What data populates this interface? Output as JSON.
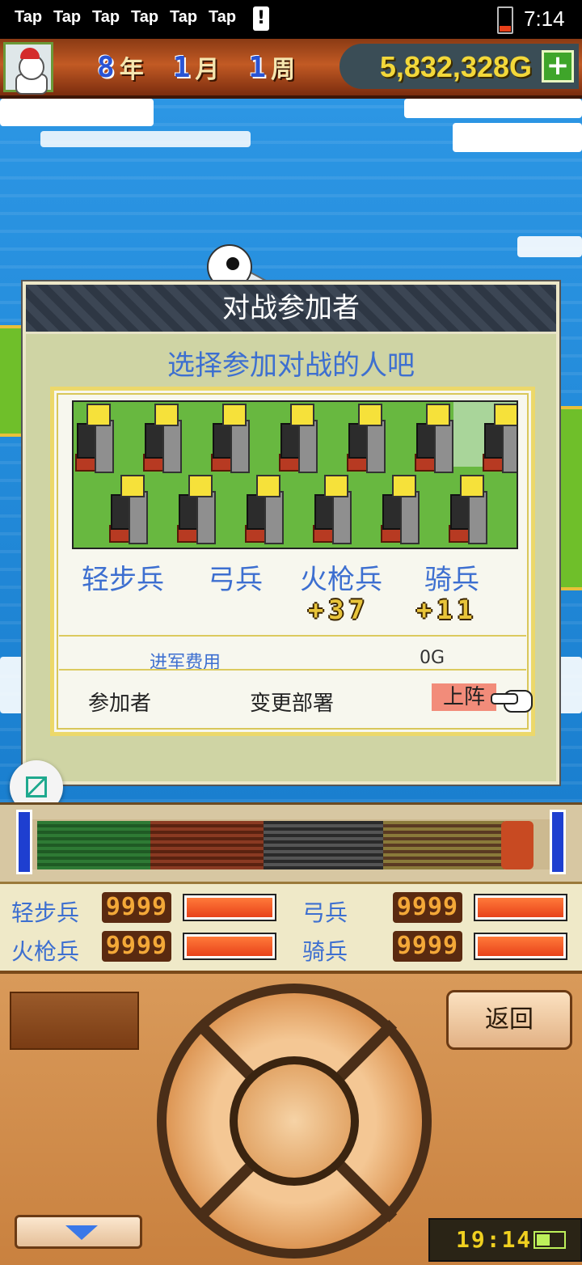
{
  "status_bar": {
    "tap_labels": [
      "Tap",
      "Tap",
      "Tap",
      "Tap",
      "Tap",
      "Tap"
    ],
    "warning_glyph": "!",
    "time": "7:14",
    "battery_level_fraction": 0.25
  },
  "header": {
    "year": "8",
    "year_unit": "年",
    "month": "1",
    "month_unit": "月",
    "week": "1",
    "week_unit": "周",
    "money": "5,832,328G",
    "add_money_glyph": "+"
  },
  "dialog": {
    "title": "对战参加者",
    "subtitle": "选择参加对战的人吧",
    "units": [
      "轻步兵",
      "弓兵",
      "火枪兵",
      "骑兵"
    ],
    "bonuses": [
      "",
      "",
      "+37",
      "+11"
    ],
    "cost_label": "进军费用",
    "cost_value": "0G",
    "participants_label": "参加者",
    "change_formation_label": "变更部署",
    "deploy_label": "上阵"
  },
  "stats": [
    {
      "label": "轻步兵",
      "value": "9999",
      "fill_fraction": 1.0
    },
    {
      "label": "弓兵",
      "value": "9999",
      "fill_fraction": 1.0
    },
    {
      "label": "火枪兵",
      "value": "9999",
      "fill_fraction": 1.0
    },
    {
      "label": "骑兵",
      "value": "9999",
      "fill_fraction": 1.0
    }
  ],
  "controls": {
    "back_label": "返回",
    "game_time": "19:14",
    "game_battery_fraction": 0.5
  },
  "colors": {
    "accent_blue": "#3d6fd0",
    "deploy_highlight": "#f28c7a",
    "money_yellow": "#f3d83a",
    "bar_fill": "#e8421a"
  }
}
